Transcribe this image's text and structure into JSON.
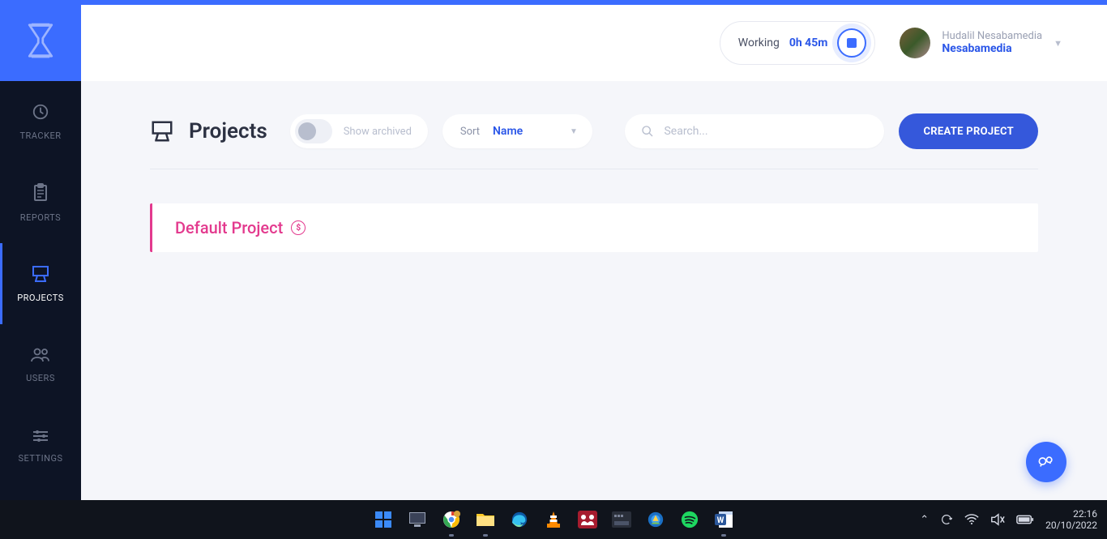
{
  "sidebar": {
    "items": [
      {
        "label": "TRACKER"
      },
      {
        "label": "REPORTS"
      },
      {
        "label": "PROJECTS"
      },
      {
        "label": "USERS"
      },
      {
        "label": "SETTINGS"
      }
    ]
  },
  "header": {
    "timer": {
      "status_label": "Working",
      "time": "0h 45m"
    },
    "user": {
      "full_name": "Hudalil Nesabamedia",
      "org": "Nesabamedia"
    }
  },
  "page": {
    "title": "Projects",
    "archive_label": "Show archived",
    "sort_label": "Sort",
    "sort_value": "Name",
    "search_placeholder": "Search...",
    "create_button": "CREATE PROJECT"
  },
  "projects": [
    {
      "name": "Default Project"
    }
  ],
  "taskbar": {
    "time": "22:16",
    "date": "20/10/2022"
  }
}
